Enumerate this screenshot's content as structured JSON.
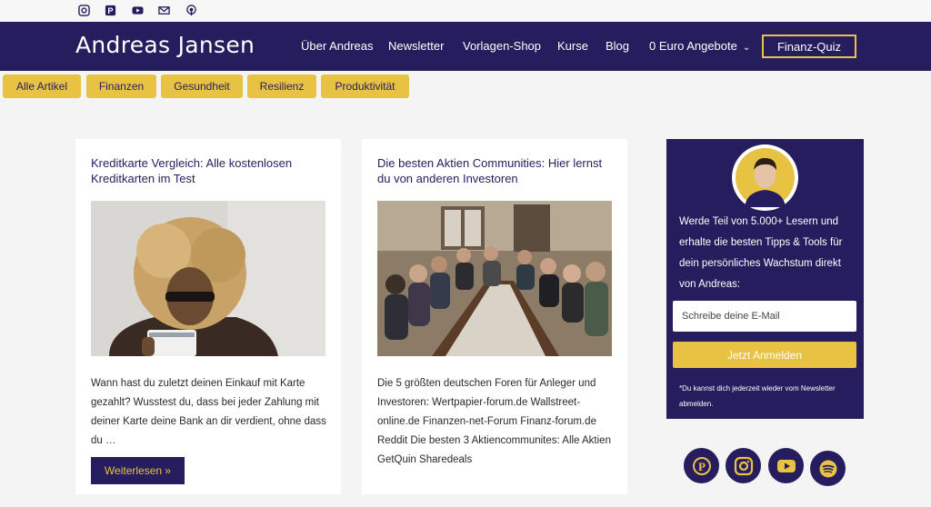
{
  "topbar": {
    "icons": [
      "instagram-icon",
      "pinterest-icon",
      "youtube-icon",
      "mail-icon",
      "podcast-icon"
    ]
  },
  "header": {
    "logo": "Andreas Jansen",
    "nav": {
      "about": "Über Andreas",
      "newsletter": "Newsletter",
      "shop": "Vorlagen-Shop",
      "courses": "Kurse",
      "blog": "Blog",
      "offers": "0 Euro Angebote"
    },
    "cta": "Finanz-Quiz"
  },
  "categories": {
    "all": "Alle Artikel",
    "finance": "Finanzen",
    "health": "Gesundheit",
    "resilience": "Resilienz",
    "productivity": "Produktivität"
  },
  "posts": [
    {
      "title": "Kreditkarte Vergleich: Alle kostenlosen Kreditkarten im Test",
      "excerpt": "Wann hast du zuletzt deinen Einkauf mit Karte gezahlt? Wusstest du, dass bei jeder Zahlung mit deiner Karte deine Bank an dir verdient, ohne dass du …",
      "read_more": "Weiterlesen »"
    },
    {
      "title": "Die besten Aktien Communities: Hier lernst du von anderen Investoren",
      "excerpt": "Die 5 größten deutschen Foren für Anleger und Investoren: Wertpapier-forum.de Wallstreet-online.de Finanzen-net-Forum Finanz-forum.de Reddit Die besten 3 Aktiencommunites: Alle Aktien GetQuin Sharedeals"
    }
  ],
  "sidebar": {
    "signup_text": "Werde Teil von 5.000+ Lesern und erhalte die besten Tipps & Tools für dein persönliches Wachstum direkt von Andreas:",
    "email_placeholder": "Schreibe deine E-Mail",
    "submit": "Jetzt Anmelden",
    "note": "*Du kannst dich jederzeit wieder vom Newsletter abmelden.",
    "social": [
      "pinterest-icon",
      "instagram-icon",
      "youtube-icon",
      "spotify-icon"
    ]
  },
  "colors": {
    "brand": "#261d5e",
    "accent": "#e8c243",
    "background": "#f4f4f5"
  }
}
